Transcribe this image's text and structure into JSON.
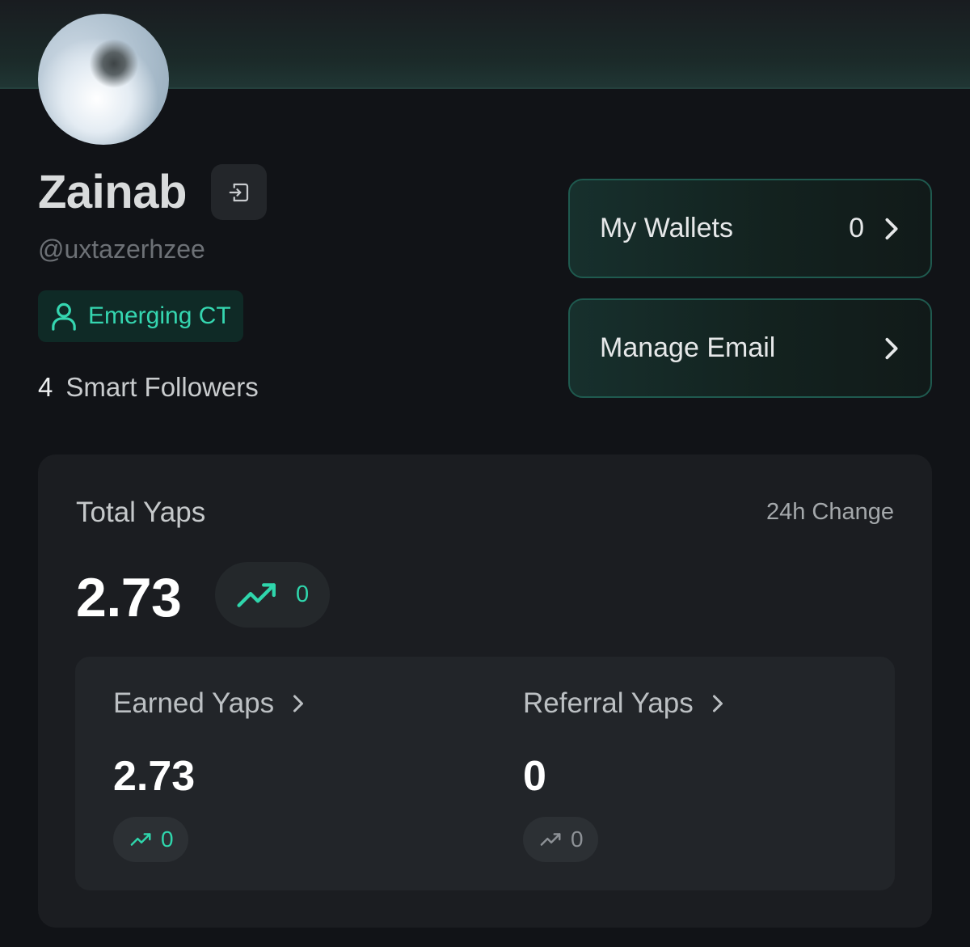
{
  "profile": {
    "name": "Zainab",
    "handle": "@uxtazerhzee",
    "tier_badge": "Emerging CT",
    "smart_followers": {
      "count": "4",
      "label": "Smart Followers"
    }
  },
  "actions": {
    "wallets": {
      "label": "My Wallets",
      "value": "0"
    },
    "email": {
      "label": "Manage Email"
    }
  },
  "yaps": {
    "title": "Total Yaps",
    "change_label": "24h Change",
    "total": "2.73",
    "total_change": "0",
    "earned": {
      "label": "Earned Yaps",
      "value": "2.73",
      "change": "0"
    },
    "referral": {
      "label": "Referral Yaps",
      "value": "0",
      "change": "0"
    }
  },
  "colors": {
    "background": "#111317",
    "accent": "#2fd6ac",
    "card": "#1b1d21",
    "inner_card": "#222529"
  },
  "icons": {
    "logout": "logout-icon",
    "tier": "user-icon",
    "chevron": "chevron-right-icon",
    "trend": "trending-up-icon"
  }
}
